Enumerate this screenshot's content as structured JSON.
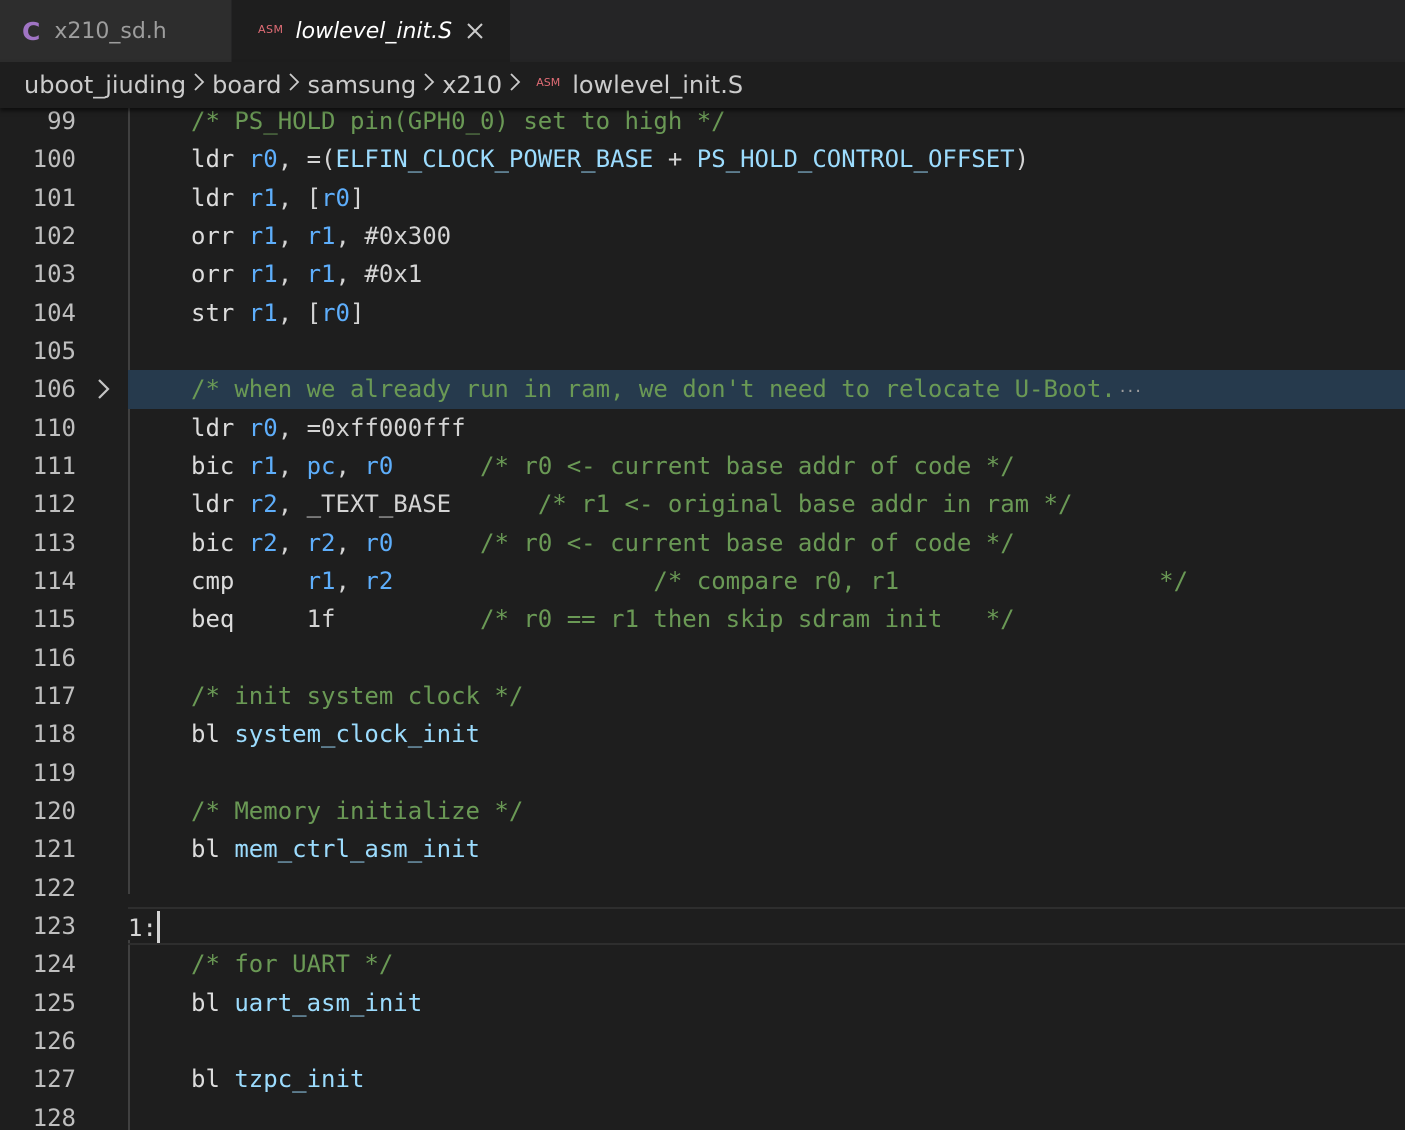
{
  "tabs": [
    {
      "icon": "C",
      "label": "x210_sd.h",
      "active": false
    },
    {
      "icon": "ASM",
      "label": "lowlevel_init.S",
      "active": true
    }
  ],
  "breadcrumb": {
    "items": [
      "uboot_jiuding",
      "board",
      "samsung",
      "x210"
    ],
    "file_icon": "ASM",
    "file": "lowlevel_init.S"
  },
  "editor": {
    "lines": [
      {
        "n": "99",
        "tokens": [
          [
            "c",
            "/* PS_HOLD pin(GPH0_0) set to high */"
          ]
        ]
      },
      {
        "n": "100",
        "tokens": [
          [
            "k",
            "ldr "
          ],
          [
            "r",
            "r0"
          ],
          [
            "p",
            ", =("
          ],
          [
            "i",
            "ELFIN_CLOCK_POWER_BASE"
          ],
          [
            "p",
            " + "
          ],
          [
            "i",
            "PS_HOLD_CONTROL_OFFSET"
          ],
          [
            "p",
            ")"
          ]
        ]
      },
      {
        "n": "101",
        "tokens": [
          [
            "k",
            "ldr "
          ],
          [
            "r",
            "r1"
          ],
          [
            "p",
            ", ["
          ],
          [
            "r",
            "r0"
          ],
          [
            "p",
            "]"
          ]
        ]
      },
      {
        "n": "102",
        "tokens": [
          [
            "k",
            "orr "
          ],
          [
            "r",
            "r1"
          ],
          [
            "p",
            ", "
          ],
          [
            "r",
            "r1"
          ],
          [
            "p",
            ", "
          ],
          [
            "n",
            "#0x300"
          ]
        ]
      },
      {
        "n": "103",
        "tokens": [
          [
            "k",
            "orr "
          ],
          [
            "r",
            "r1"
          ],
          [
            "p",
            ", "
          ],
          [
            "r",
            "r1"
          ],
          [
            "p",
            ", "
          ],
          [
            "n",
            "#0x1"
          ]
        ]
      },
      {
        "n": "104",
        "tokens": [
          [
            "k",
            "str "
          ],
          [
            "r",
            "r1"
          ],
          [
            "p",
            ", ["
          ],
          [
            "r",
            "r0"
          ],
          [
            "p",
            "]"
          ]
        ]
      },
      {
        "n": "105",
        "tokens": []
      },
      {
        "n": "106",
        "folded": true,
        "tokens": [
          [
            "c",
            "/* when we already run in ram, we don't need to relocate U-Boot."
          ]
        ],
        "ellipsis": "···"
      },
      {
        "n": "110",
        "tokens": [
          [
            "k",
            "ldr "
          ],
          [
            "r",
            "r0"
          ],
          [
            "p",
            ", "
          ],
          [
            "n",
            "=0xff000fff"
          ]
        ]
      },
      {
        "n": "111",
        "tokens": [
          [
            "k",
            "bic "
          ],
          [
            "r",
            "r1"
          ],
          [
            "p",
            ", "
          ],
          [
            "r",
            "pc"
          ],
          [
            "p",
            ", "
          ],
          [
            "r",
            "r0"
          ],
          [
            "p",
            "      "
          ],
          [
            "c",
            "/* r0 <- current base addr of code */"
          ]
        ]
      },
      {
        "n": "112",
        "tokens": [
          [
            "k",
            "ldr "
          ],
          [
            "r",
            "r2"
          ],
          [
            "p",
            ", "
          ],
          [
            "n",
            "_TEXT_BASE"
          ],
          [
            "p",
            "      "
          ],
          [
            "c",
            "/* r1 <- original base addr in ram */"
          ]
        ]
      },
      {
        "n": "113",
        "tokens": [
          [
            "k",
            "bic "
          ],
          [
            "r",
            "r2"
          ],
          [
            "p",
            ", "
          ],
          [
            "r",
            "r2"
          ],
          [
            "p",
            ", "
          ],
          [
            "r",
            "r0"
          ],
          [
            "p",
            "      "
          ],
          [
            "c",
            "/* r0 <- current base addr of code */"
          ]
        ]
      },
      {
        "n": "114",
        "tokens": [
          [
            "k",
            "cmp     "
          ],
          [
            "r",
            "r1"
          ],
          [
            "p",
            ", "
          ],
          [
            "r",
            "r2"
          ],
          [
            "p",
            "                  "
          ],
          [
            "c",
            "/* compare r0, r1                  */"
          ]
        ]
      },
      {
        "n": "115",
        "tokens": [
          [
            "k",
            "beq     "
          ],
          [
            "n",
            "1f"
          ],
          [
            "p",
            "          "
          ],
          [
            "c",
            "/* r0 == r1 then skip sdram init   */"
          ]
        ]
      },
      {
        "n": "116",
        "tokens": []
      },
      {
        "n": "117",
        "tokens": [
          [
            "c",
            "/* init system clock */"
          ]
        ]
      },
      {
        "n": "118",
        "tokens": [
          [
            "k",
            "bl "
          ],
          [
            "i",
            "system_clock_init"
          ]
        ]
      },
      {
        "n": "119",
        "tokens": []
      },
      {
        "n": "120",
        "tokens": [
          [
            "c",
            "/* Memory initialize */"
          ]
        ]
      },
      {
        "n": "121",
        "tokens": [
          [
            "k",
            "bl "
          ],
          [
            "i",
            "mem_ctrl_asm_init"
          ]
        ]
      },
      {
        "n": "122",
        "tokens": []
      },
      {
        "n": "123",
        "label": true,
        "current": true,
        "tokens": [
          [
            "p",
            "1:"
          ]
        ]
      },
      {
        "n": "124",
        "tokens": [
          [
            "c",
            "/* for UART */"
          ]
        ]
      },
      {
        "n": "125",
        "tokens": [
          [
            "k",
            "bl "
          ],
          [
            "i",
            "uart_asm_init"
          ]
        ]
      },
      {
        "n": "126",
        "tokens": []
      },
      {
        "n": "127",
        "tokens": [
          [
            "k",
            "bl "
          ],
          [
            "i",
            "tzpc_init"
          ]
        ]
      },
      {
        "n": "128",
        "tokens": []
      }
    ]
  },
  "colors": {
    "background": "#1e1e1e",
    "keyword": "#dcdcdc",
    "register": "#5eaefb",
    "identifier": "#9cdcfe",
    "comment": "#6a9955",
    "fold_highlight": "#263a4d",
    "c_icon": "#a074c4",
    "asm_icon": "#e06c75"
  }
}
